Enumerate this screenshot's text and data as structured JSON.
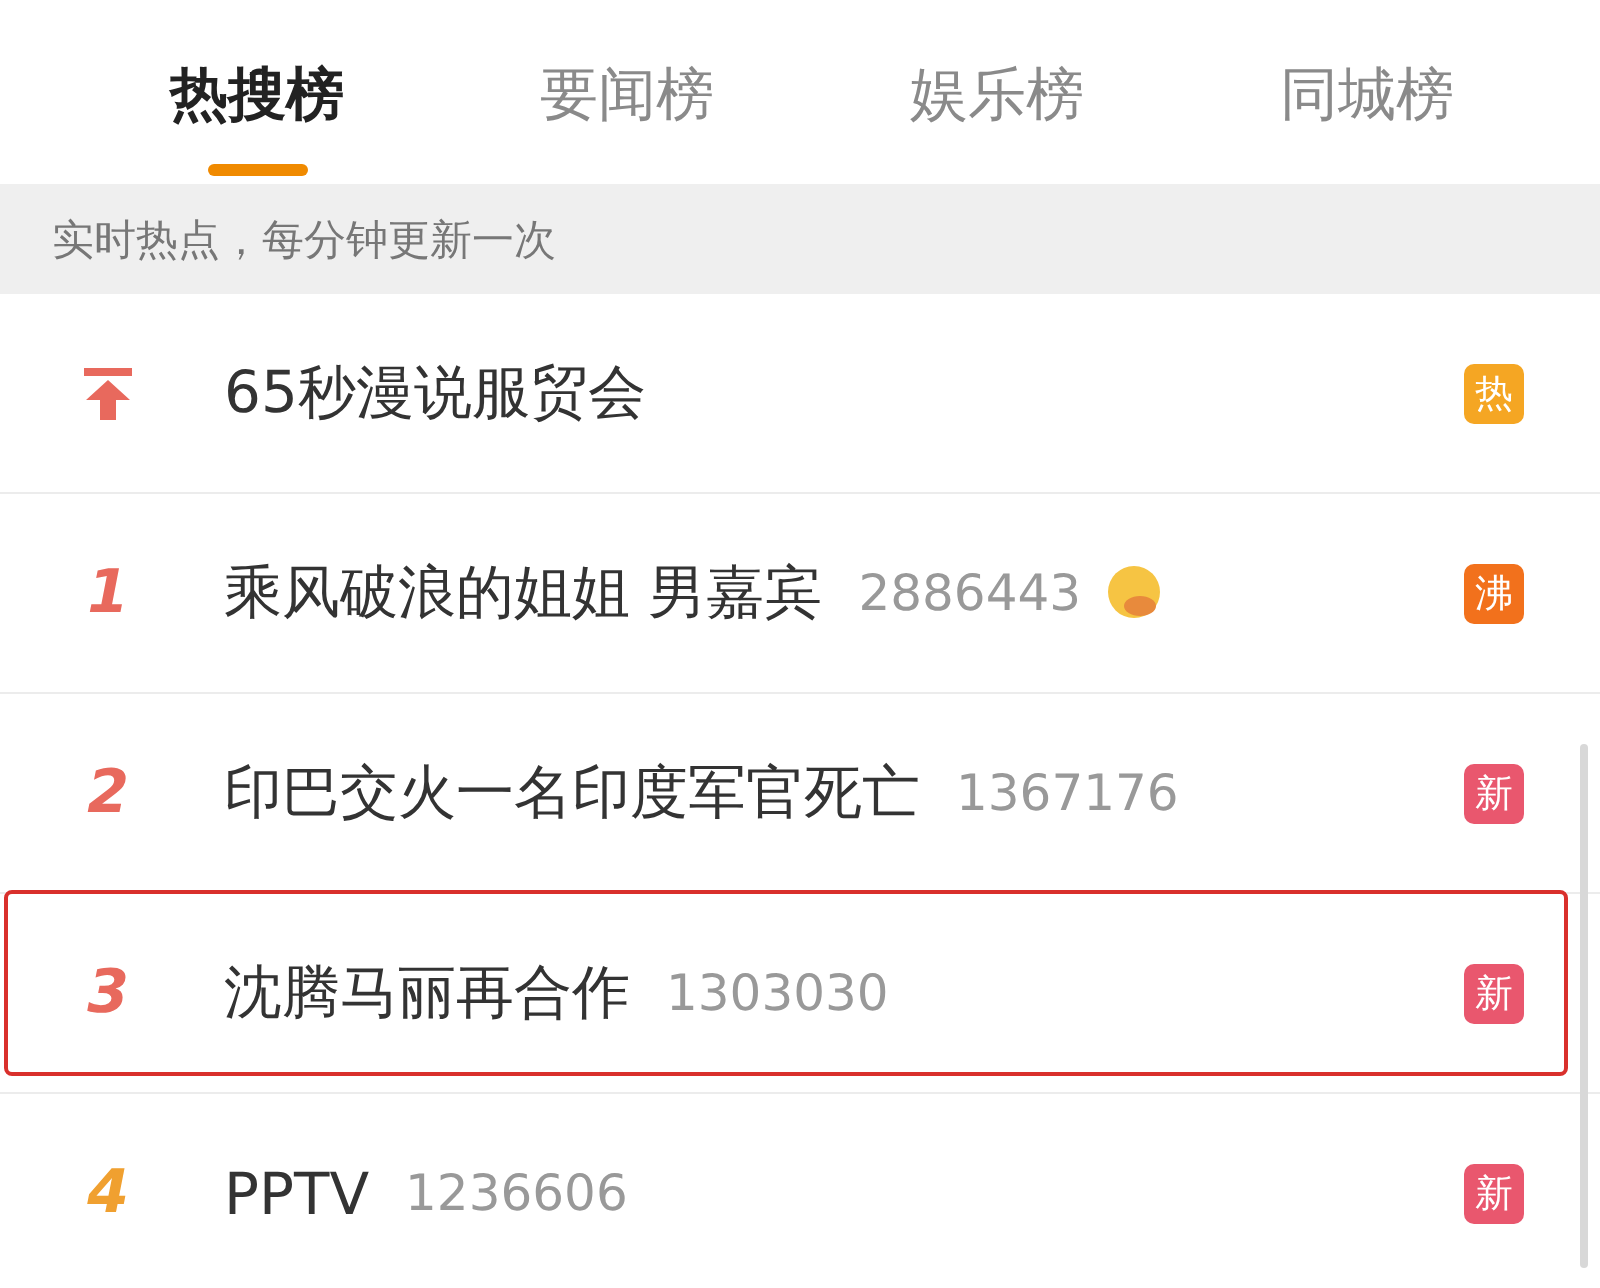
{
  "tabs": [
    {
      "label": "热搜榜",
      "selected": true
    },
    {
      "label": "要闻榜",
      "selected": false
    },
    {
      "label": "娱乐榜",
      "selected": false
    },
    {
      "label": "同城榜",
      "selected": false
    }
  ],
  "notice": "实时热点，每分钟更新一次",
  "rows": [
    {
      "kind": "pinned",
      "color": "#e8695d",
      "title": "65秒漫说服贸会",
      "emoji": false,
      "highlighted": false,
      "badge": {
        "label": "热",
        "color": "#f5a623"
      }
    },
    {
      "kind": "ranked",
      "rank": "1",
      "color": "#e8695d",
      "title": "乘风破浪的姐姐 男嘉宾",
      "count": "2886443",
      "emoji": true,
      "highlighted": false,
      "badge": {
        "label": "沸",
        "color": "#f2711c"
      }
    },
    {
      "kind": "ranked",
      "rank": "2",
      "color": "#e8695d",
      "title": "印巴交火一名印度军官死亡",
      "count": "1367176",
      "emoji": false,
      "highlighted": false,
      "badge": {
        "label": "新",
        "color": "#e9576e"
      }
    },
    {
      "kind": "ranked",
      "rank": "3",
      "color": "#e8695d",
      "title": "沈腾马丽再合作",
      "count": "1303030",
      "emoji": false,
      "highlighted": true,
      "badge": {
        "label": "新",
        "color": "#e9576e"
      }
    },
    {
      "kind": "ranked",
      "rank": "4",
      "color": "#f0a030",
      "title": "PPTV",
      "count": "1236606",
      "emoji": false,
      "highlighted": false,
      "badge": {
        "label": "新",
        "color": "#e9576e"
      }
    }
  ]
}
